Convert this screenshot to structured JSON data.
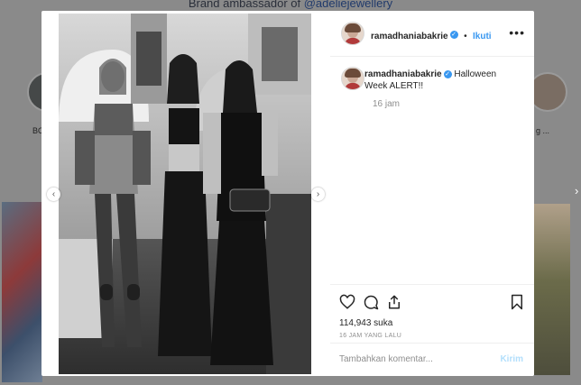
{
  "background": {
    "bio_prefix": "Brand ambassador of ",
    "bio_handle": "@adeliejewellery",
    "highlights": [
      {
        "label": "BO"
      },
      {
        "label": "g ..."
      }
    ]
  },
  "post": {
    "username": "ramadhaniabakrie",
    "verified": true,
    "dot": "•",
    "follow_label": "Ikuti",
    "more_label": "•••",
    "caption_username": "ramadhaniabakrie",
    "caption_text": "Halloween Week ALERT!!",
    "caption_time": "16 jam",
    "likes": "114,943 suka",
    "time_ago": "16 JAM YANG LALU",
    "comment_placeholder": "Tambahkan komentar...",
    "post_button": "Kirim"
  },
  "colors": {
    "accent": "#3897f0",
    "post_disabled": "#b2dffc"
  },
  "icons": [
    "heart-icon",
    "comment-icon",
    "share-icon",
    "bookmark-icon",
    "more-options-icon",
    "verified-badge-icon",
    "prev-arrow-icon",
    "next-arrow-icon"
  ]
}
